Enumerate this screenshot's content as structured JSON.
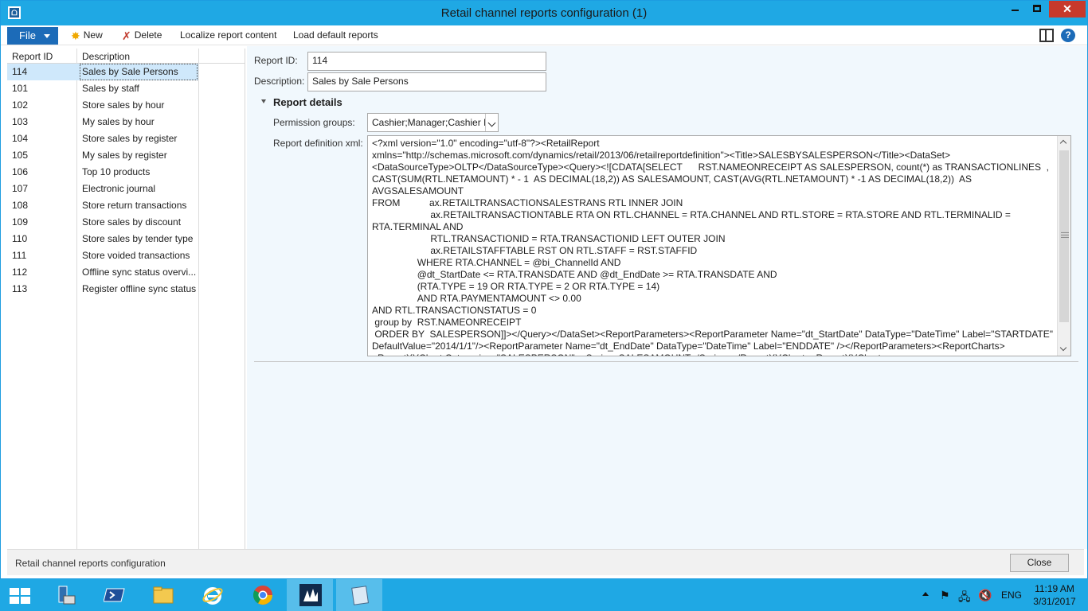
{
  "window": {
    "title": "Retail channel reports configuration (1)",
    "icon_label": "ᗝ"
  },
  "toolbar": {
    "file_label": "File",
    "new_label": "New",
    "delete_label": "Delete",
    "localize_label": "Localize report content",
    "load_default_label": "Load default reports",
    "help_label": "?"
  },
  "grid": {
    "headers": {
      "id": "Report ID",
      "description": "Description"
    },
    "rows": [
      {
        "id": "114",
        "description": "Sales by Sale Persons"
      },
      {
        "id": "101",
        "description": "Sales by staff"
      },
      {
        "id": "102",
        "description": "Store sales by hour"
      },
      {
        "id": "103",
        "description": "My sales by hour"
      },
      {
        "id": "104",
        "description": "Store sales by register"
      },
      {
        "id": "105",
        "description": "My sales by register"
      },
      {
        "id": "106",
        "description": "Top 10 products"
      },
      {
        "id": "107",
        "description": "Electronic journal"
      },
      {
        "id": "108",
        "description": "Store return transactions"
      },
      {
        "id": "109",
        "description": "Store sales by discount"
      },
      {
        "id": "110",
        "description": "Store sales by tender type"
      },
      {
        "id": "111",
        "description": "Store voided transactions"
      },
      {
        "id": "112",
        "description": "Offline sync status overvi..."
      },
      {
        "id": "113",
        "description": "Register offline sync status"
      }
    ],
    "selected_index": 0
  },
  "detail": {
    "report_id_label": "Report ID:",
    "report_id_value": "114",
    "description_label": "Description:",
    "description_value": "Sales by Sale Persons",
    "section_title": "Report details",
    "permission_label": "Permission groups:",
    "permission_value": "Cashier;Manager;Cashier P",
    "xml_label": "Report definition xml:",
    "xml_value": "<?xml version=\"1.0\" encoding=\"utf-8\"?><RetailReport\nxmlns=\"http://schemas.microsoft.com/dynamics/retail/2013/06/retailreportdefinition\"><Title>SALESBYSALESPERSON</Title><DataSet><DataSourceType>OLTP</DataSourceType><Query><![CDATA[SELECT      RST.NAMEONRECEIPT AS SALESPERSON, count(*) as TRANSACTIONLINES  , CAST(SUM(RTL.NETAMOUNT) * - 1  AS DECIMAL(18,2)) AS SALESAMOUNT, CAST(AVG(RTL.NETAMOUNT) * -1 AS DECIMAL(18,2))  AS AVGSALESAMOUNT\nFROM           ax.RETAILTRANSACTIONSALESTRANS RTL INNER JOIN\n                      ax.RETAILTRANSACTIONTABLE RTA ON RTL.CHANNEL = RTA.CHANNEL AND RTL.STORE = RTA.STORE AND RTL.TERMINALID = RTA.TERMINAL AND\n                      RTL.TRANSACTIONID = RTA.TRANSACTIONID LEFT OUTER JOIN\n                      ax.RETAILSTAFFTABLE RST ON RTL.STAFF = RST.STAFFID\n                 WHERE RTA.CHANNEL = @bi_ChannelId AND\n                 @dt_StartDate <= RTA.TRANSDATE AND @dt_EndDate >= RTA.TRANSDATE AND\n                 (RTA.TYPE = 19 OR RTA.TYPE = 2 OR RTA.TYPE = 14)\n                 AND RTA.PAYMENTAMOUNT <> 0.00\nAND RTL.TRANSACTIONSTATUS = 0\n group by  RST.NAMEONRECEIPT\n ORDER BY  SALESPERSON]]></Query></DataSet><ReportParameters><ReportParameter Name=\"dt_StartDate\" DataType=\"DateTime\" Label=\"STARTDATE\" DefaultValue=\"2014/1/1\"/><ReportParameter Name=\"dt_EndDate\" DataType=\"DateTime\" Label=\"ENDDATE\" /></ReportParameters><ReportCharts><ReportXYChart Categories=\"SALESPERSON\"><Series>SALESAMOUNT</Series></ReportXYChart><ReportXYChart"
  },
  "statusbar": {
    "text": "Retail channel reports configuration",
    "close_label": "Close"
  },
  "taskbar": {
    "language": "ENG",
    "time": "11:19 AM",
    "date": "3/31/2017"
  },
  "colors": {
    "accent": "#1fa8e4",
    "file_button": "#1c6bb8",
    "selection": "#cfe8fb",
    "close_button": "#c7392b"
  }
}
